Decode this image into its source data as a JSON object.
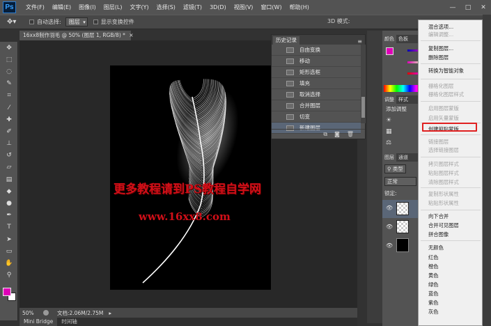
{
  "app": {
    "logo": "Ps",
    "menus": [
      "文件(F)",
      "编辑(E)",
      "图像(I)",
      "图层(L)",
      "文字(Y)",
      "选择(S)",
      "滤镜(T)",
      "3D(D)",
      "视图(V)",
      "窗口(W)",
      "帮助(H)"
    ],
    "window_controls": [
      "—",
      "□",
      "✕"
    ]
  },
  "options_bar": {
    "auto_select_label": "自动选择:",
    "auto_select_value": "图层",
    "show_transform_label": "显示变换控件",
    "mode_3d_label": "3D 模式:"
  },
  "document": {
    "tab_title": "16xx8制作羽毛 @ 50% (图层 1, RGB/8) *",
    "tab_close": "×",
    "watermark_line1": "更多教程请到PS教程自学网",
    "watermark_line2": "www.16xx8.com"
  },
  "status_bar": {
    "zoom": "50%",
    "doc_info": "文档:2.06M/2.75M"
  },
  "bottom_tabs": [
    "Mini Bridge",
    "时间轴"
  ],
  "history_panel": {
    "title": "历史记录",
    "items": [
      "自由变换",
      "移动",
      "矩形选框",
      "填充",
      "取消选择",
      "合并图层",
      "切变",
      "新建图层"
    ],
    "selected_index": 7
  },
  "right_panels": {
    "color_tabs": [
      "颜色",
      "色板"
    ],
    "adjust_tabs": [
      "调整",
      "样式"
    ],
    "add_adjustment_label": "添加调整",
    "layers_tabs": [
      "图层",
      "通道"
    ],
    "kind_label": "类型",
    "blend_mode": "正常",
    "lock_label": "锁定:"
  },
  "context_menu": {
    "items": [
      {
        "label": "混合选项...",
        "enabled": true
      },
      {
        "label": "编辑调整...",
        "enabled": false
      },
      {
        "label": "复制图层...",
        "enabled": true
      },
      {
        "label": "删除图层",
        "enabled": true
      },
      {
        "label": "转换为智能对象",
        "enabled": true
      },
      {
        "label": "栅格化图层",
        "enabled": false
      },
      {
        "label": "栅格化图层样式",
        "enabled": false
      },
      {
        "label": "启用图层蒙版",
        "enabled": false
      },
      {
        "label": "启用矢量蒙版",
        "enabled": false
      },
      {
        "label": "创建剪贴蒙版",
        "enabled": true
      },
      {
        "label": "链接图层",
        "enabled": false
      },
      {
        "label": "选择链接图层",
        "enabled": false
      },
      {
        "label": "拷贝图层样式",
        "enabled": false
      },
      {
        "label": "粘贴图层样式",
        "enabled": false
      },
      {
        "label": "清除图层样式",
        "enabled": false
      },
      {
        "label": "复制形状属性",
        "enabled": false
      },
      {
        "label": "粘贴形状属性",
        "enabled": false
      },
      {
        "label": "向下合并",
        "enabled": true
      },
      {
        "label": "合并可见图层",
        "enabled": true
      },
      {
        "label": "拼合图像",
        "enabled": true
      },
      {
        "label": "无颜色",
        "enabled": true
      },
      {
        "label": "红色",
        "enabled": true
      },
      {
        "label": "橙色",
        "enabled": true
      },
      {
        "label": "黄色",
        "enabled": true
      },
      {
        "label": "绿色",
        "enabled": true
      },
      {
        "label": "蓝色",
        "enabled": true
      },
      {
        "label": "紫色",
        "enabled": true
      },
      {
        "label": "灰色",
        "enabled": true
      }
    ],
    "highlighted_label": "创建剪贴蒙版"
  },
  "colors": {
    "foreground": "#e000b8",
    "background": "#ffffff",
    "watermark": "#d10f18",
    "history_selected": "#5a6677",
    "highlight_box": "#e02020"
  }
}
